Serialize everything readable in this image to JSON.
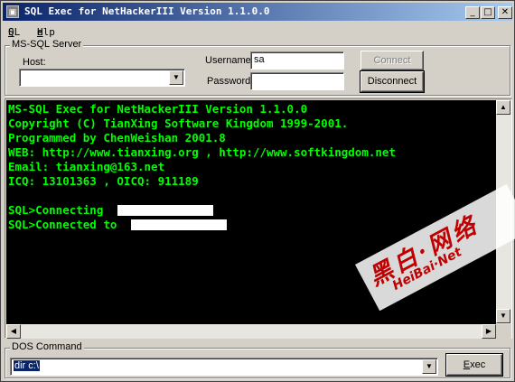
{
  "window": {
    "title": "SQL Exec for NetHackerIII Version 1.1.0.0",
    "min_glyph": "_",
    "max_glyph": "□",
    "close_glyph": "✕"
  },
  "menu": {
    "sql_first": "S",
    "sql_rest": "QL",
    "help_first": "H",
    "help_rest": "elp"
  },
  "server": {
    "group_label": "MS-SQL Server",
    "host_label": "Host:",
    "host_value": "",
    "username_label": "Username",
    "username_value": "sa",
    "password_label": "Password",
    "password_value": "",
    "connect_label": "Connect",
    "disconnect_label": "Disconnect"
  },
  "console": {
    "lines": [
      "MS-SQL Exec for NetHackerIII Version 1.1.0.0",
      "Copyright (C) TianXing Software Kingdom 1999-2001.",
      "Programmed by ChenWeishan 2001.8",
      "WEB: http://www.tianxing.org , http://www.softkingdom.net",
      "Email: tianxing@163.net",
      "ICQ: 13101363 , OICQ: 911189",
      "",
      "SQL>Connecting ",
      "SQL>Connected to "
    ],
    "text_color": "#00ff00",
    "background": "#000000"
  },
  "dos": {
    "group_label": "DOS Command",
    "command_value": "dir c:\\",
    "exec_first": "E",
    "exec_rest": "xec"
  },
  "watermark": {
    "chinese": "黑白·网络",
    "english": "HeiBai·Net"
  },
  "colors": {
    "titlebar_start": "#0a246a",
    "titlebar_end": "#a6caf0",
    "face": "#d4d0c8",
    "watermark": "#c00000"
  },
  "icons": {
    "dropdown": "chevron-down-icon",
    "scroll_up": "arrow-up-icon",
    "scroll_down": "arrow-down-icon",
    "scroll_left": "arrow-left-icon",
    "scroll_right": "arrow-right-icon"
  }
}
